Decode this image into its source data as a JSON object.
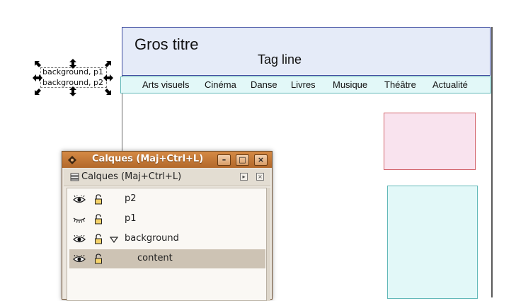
{
  "page_mockup": {
    "title": "Gros titre",
    "tagline": "Tag line",
    "nav": [
      "Arts visuels",
      "Cinéma",
      "Danse",
      "Livres",
      "Musique",
      "Théâtre",
      "Actualité"
    ]
  },
  "selected_text": {
    "line1": "background, p1",
    "line2": "background, p2"
  },
  "layers_dialog": {
    "title": "Calques (Maj+Ctrl+L)",
    "panel_label": "Calques (Maj+Ctrl+L)",
    "layers": [
      {
        "name": "p2",
        "visible": true,
        "locked": false
      },
      {
        "name": "p1",
        "visible": false,
        "locked": false
      },
      {
        "name": "background",
        "visible": true,
        "locked": false,
        "expanded": true
      },
      {
        "name": "content",
        "visible": true,
        "locked": false,
        "selected": true
      }
    ]
  },
  "colors": {
    "header_bg": "#e5ebf8",
    "nav_bg": "#e2f8f8",
    "pink_box": "#f9e3ee",
    "titlebar": "#c27a38"
  }
}
